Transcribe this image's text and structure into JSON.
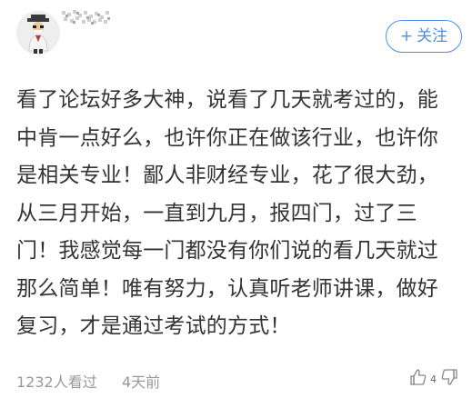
{
  "header": {
    "follow_label": "关注",
    "follow_icon": "plus-icon"
  },
  "post": {
    "lines": [
      "看了论坛好多大神，说看了几天就考过的，能",
      "中肯一点好么，也许你正在做该行业，也许你",
      "是相关专业！鄙人非财经专业，花了很大劲，",
      "从三月开始，一直到九月，报四门，过了三",
      "门！我感觉每一门都没有你们说的看几天就过",
      "那么简单！唯有努力，认真听老师讲课，做好",
      "复习，才是通过考试的方式！"
    ]
  },
  "footer": {
    "views": "1232人看过",
    "time": "4天前",
    "like_count": "4",
    "like_icon": "thumbs-up-icon",
    "dislike_icon": "thumbs-down-icon"
  },
  "colors": {
    "accent": "#4a8fe6",
    "text": "#333333",
    "muted": "#999999"
  }
}
